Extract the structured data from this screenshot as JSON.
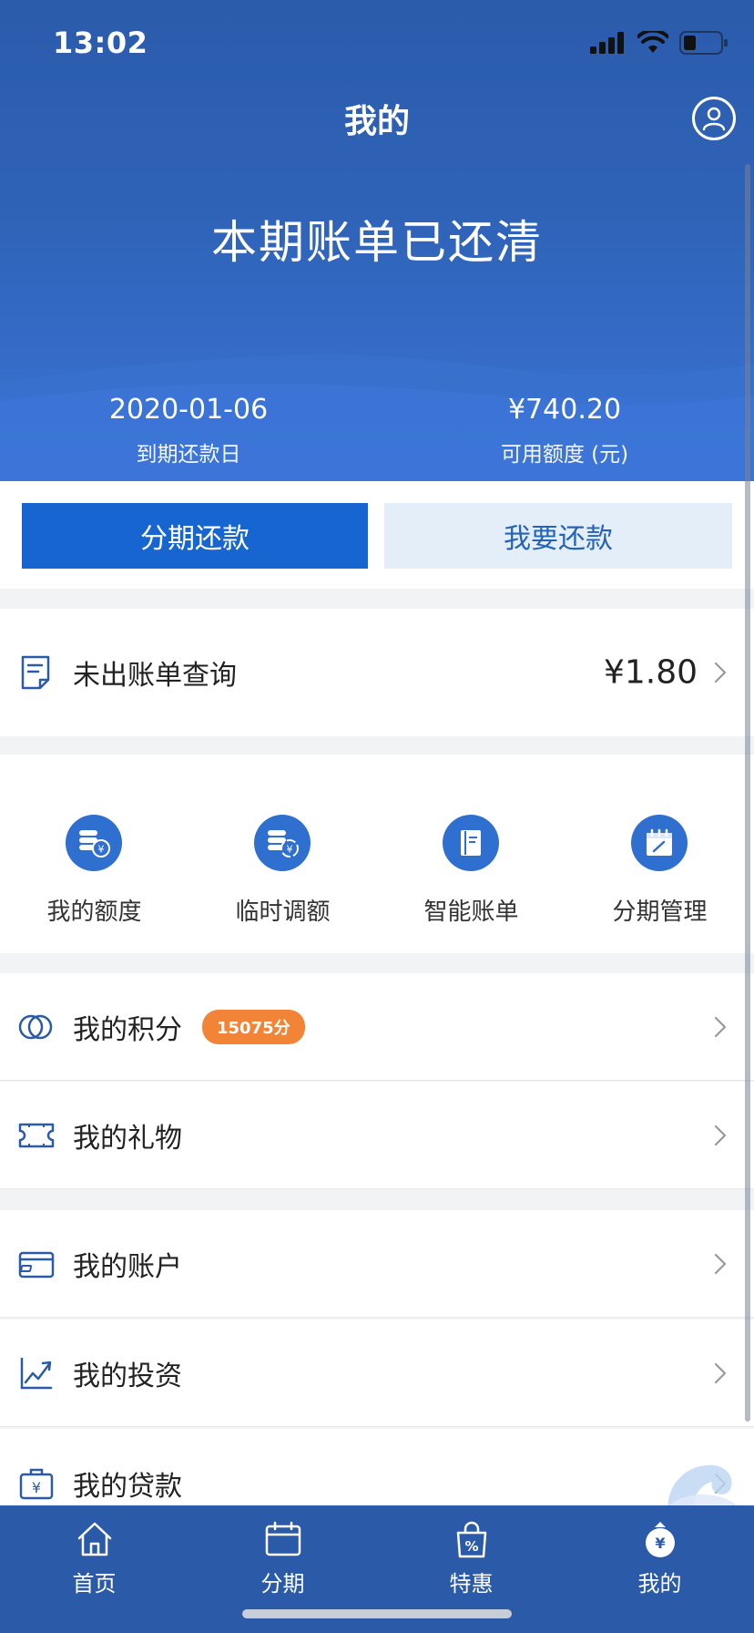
{
  "status_bar": {
    "time": "13:02"
  },
  "header": {
    "title": "我的",
    "headline": "本期账单已还清",
    "due_date": {
      "value": "2020-01-06",
      "label": "到期还款日"
    },
    "available_credit": {
      "value": "¥740.20",
      "label": "可用额度 (元)"
    }
  },
  "actions": {
    "installment": "分期还款",
    "repay": "我要还款"
  },
  "unbilled": {
    "label": "未出账单查询",
    "amount": "¥1.80"
  },
  "shortcuts": [
    {
      "label": "我的额度",
      "icon": "coins-yen-icon"
    },
    {
      "label": "临时调额",
      "icon": "coins-adjust-icon"
    },
    {
      "label": "智能账单",
      "icon": "book-icon"
    },
    {
      "label": "分期管理",
      "icon": "calendar-edit-icon"
    }
  ],
  "menu": {
    "points": {
      "label": "我的积分",
      "badge": "15075分"
    },
    "gifts": {
      "label": "我的礼物"
    },
    "account": {
      "label": "我的账户"
    },
    "investment": {
      "label": "我的投资"
    },
    "loan": {
      "label": "我的贷款"
    }
  },
  "tabbar": [
    {
      "label": "首页",
      "icon": "home-icon"
    },
    {
      "label": "分期",
      "icon": "calendar-icon"
    },
    {
      "label": "特惠",
      "icon": "shopping-bag-percent-icon"
    },
    {
      "label": "我的",
      "icon": "money-bag-yen-icon"
    }
  ],
  "colors": {
    "primary": "#1765d0",
    "header": "#2f63b8",
    "badge": "#f28437",
    "tabbar": "#2a5aa8"
  }
}
